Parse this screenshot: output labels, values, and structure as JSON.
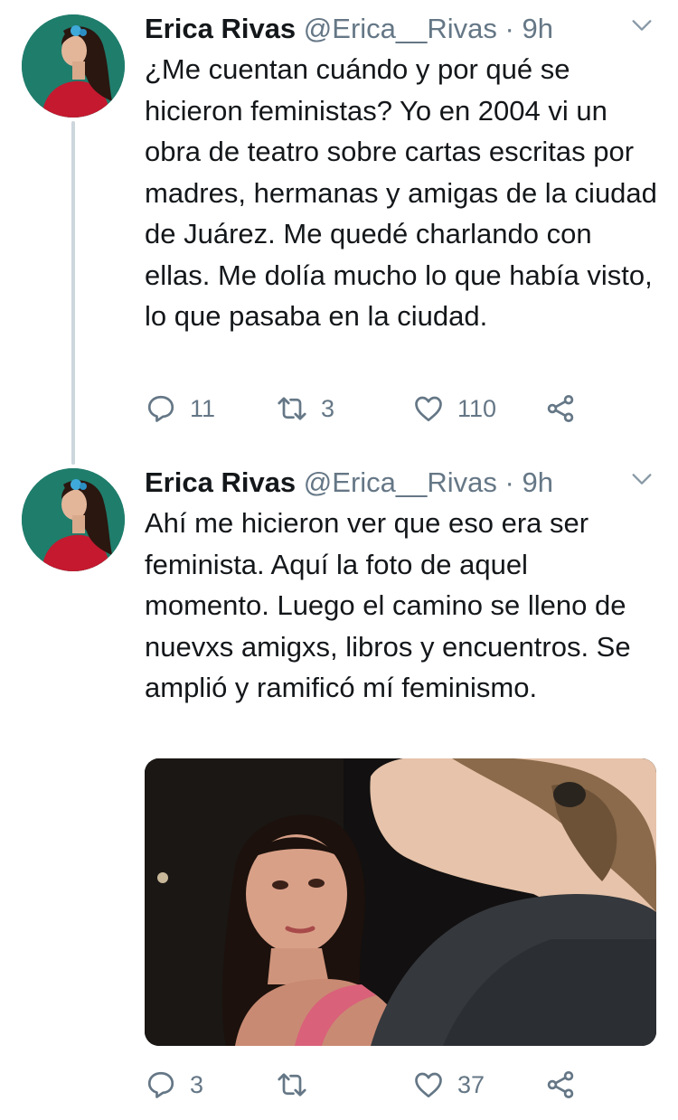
{
  "tweets": [
    {
      "author_name": "Erica Rivas",
      "handle": "@Erica__Rivas",
      "separator": "·",
      "time": "9h",
      "text": "¿Me cuentan cuándo y por qué se hicieron feministas? Yo en 2004 vi un obra de teatro sobre cartas escritas por madres, hermanas y amigas de la ciudad de Juárez. Me quedé charlando con ellas. Me dolía mucho lo que había visto, lo que pasaba en la ciudad.",
      "replies": "11",
      "retweets": "3",
      "likes": "110"
    },
    {
      "author_name": "Erica Rivas",
      "handle": "@Erica__Rivas",
      "separator": "·",
      "time": "9h",
      "text": "Ahí me hicieron ver que eso era ser feminista. Aquí la foto de aquel momento. Luego el camino se lleno de nuevxs amigxs, libros y encuentros. Se amplió y ramificó mí feminismo.",
      "replies": "3",
      "retweets": "",
      "likes": "37"
    }
  ],
  "icons": {
    "reply": "reply-icon",
    "retweet": "retweet-icon",
    "like": "heart-icon",
    "share": "share-icon",
    "menu": "chevron-down-icon"
  },
  "colors": {
    "text": "#14171a",
    "secondary": "#657786",
    "thread_line": "#ccd6dd",
    "avatar_bg": "#1d7a6a"
  }
}
